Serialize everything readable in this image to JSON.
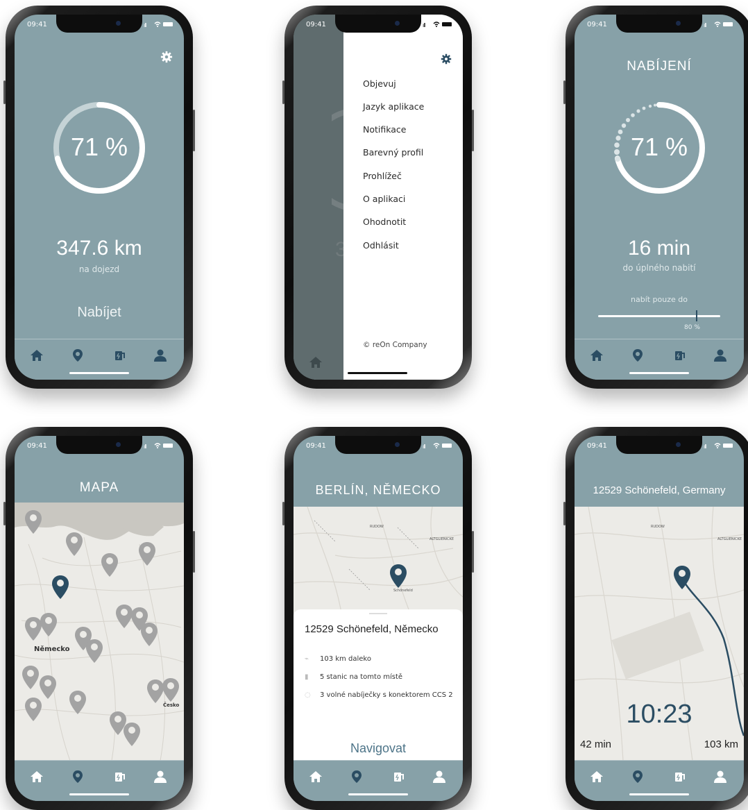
{
  "time": "09:41",
  "colors": {
    "accent": "#87a1a8",
    "dark_accent": "#2b4d63",
    "pin_gray": "#a3a3a3"
  },
  "nav_icons": [
    "home-icon",
    "map-pin-icon",
    "charging-station-icon",
    "user-icon"
  ],
  "screen1": {
    "battery_pct": "71 %",
    "battery_level": 0.71,
    "range": "347.6 km",
    "range_label": "na dojezd",
    "cta": "Nabíjet"
  },
  "screen2": {
    "menu": [
      "Objevuj",
      "Jazyk aplikace",
      "Notifikace",
      "Barevný profil",
      "Prohlížeč",
      "O aplikaci",
      "Ohodnotit",
      "Odhlásit"
    ],
    "footer": "© reOn Company",
    "bg_fragment": "3"
  },
  "screen3": {
    "title": "NABÍJENÍ",
    "battery_pct": "71 %",
    "battery_level": 0.71,
    "time_left": "16 min",
    "time_label": "do úplného nabití",
    "limit_label": "nabít pouze do",
    "limit_value": "80 %",
    "limit_level": 0.8
  },
  "screen4": {
    "title": "MAPA",
    "country_label": "Německo",
    "country_label2": "Česko"
  },
  "screen5": {
    "title": "BERLÍN, NĚMECKO",
    "map_labels": [
      "RUDOW",
      "ALTGLIENICKE",
      "Schönefeld"
    ],
    "address": "12529 Schönefeld, Německo",
    "rows": [
      "103 km daleko",
      "5 stanic na tomto místě",
      "3 volné nabíječky s konektorem CCS 2"
    ],
    "cta": "Navigovat"
  },
  "screen6": {
    "title": "12529 Schönefeld, Germany",
    "eta": "10:23",
    "duration": "42 min",
    "distance": "103 km"
  }
}
